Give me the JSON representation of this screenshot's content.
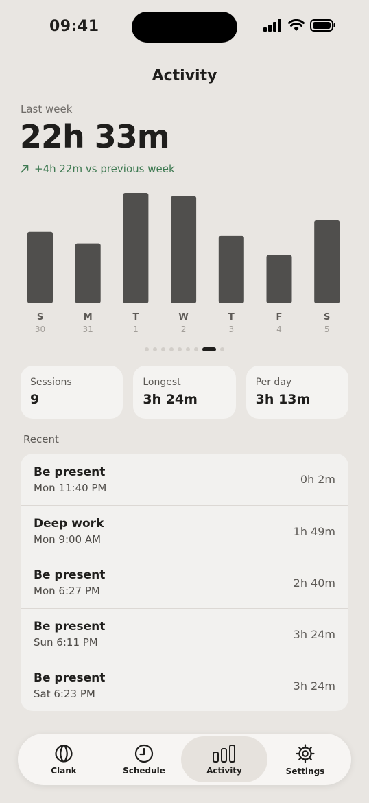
{
  "status": {
    "time": "09:41"
  },
  "header": {
    "title": "Activity"
  },
  "summary": {
    "period_label": "Last week",
    "total": "22h 33m",
    "delta": "+4h 22m vs previous week",
    "delta_color": "#3f7a52"
  },
  "chart_data": {
    "type": "bar",
    "categories": [
      "S",
      "M",
      "T",
      "W",
      "T",
      "F",
      "S"
    ],
    "dates": [
      "30",
      "31",
      "1",
      "2",
      "3",
      "4",
      "5"
    ],
    "values": [
      3.4,
      2.85,
      5.25,
      5.1,
      3.2,
      2.3,
      3.95
    ],
    "bar_color": "#504f4d"
  },
  "pager": {
    "count": 9,
    "active": 7
  },
  "stats": [
    {
      "label": "Sessions",
      "value": "9"
    },
    {
      "label": "Longest",
      "value": "3h 24m"
    },
    {
      "label": "Per day",
      "value": "3h 13m"
    }
  ],
  "recent": {
    "label": "Recent",
    "items": [
      {
        "title": "Be present",
        "subtitle": "Mon 11:40 PM",
        "duration": "0h 2m"
      },
      {
        "title": "Deep work",
        "subtitle": "Mon 9:00 AM",
        "duration": "1h 49m"
      },
      {
        "title": "Be present",
        "subtitle": "Mon 6:27 PM",
        "duration": "2h 40m"
      },
      {
        "title": "Be present",
        "subtitle": "Sun 6:11 PM",
        "duration": "3h 24m"
      },
      {
        "title": "Be present",
        "subtitle": "Sat 6:23 PM",
        "duration": "3h 24m"
      }
    ]
  },
  "tabs": [
    {
      "label": "Clank",
      "icon": "clank-icon"
    },
    {
      "label": "Schedule",
      "icon": "clock-icon"
    },
    {
      "label": "Activity",
      "icon": "bar-chart-icon"
    },
    {
      "label": "Settings",
      "icon": "gear-icon"
    }
  ]
}
